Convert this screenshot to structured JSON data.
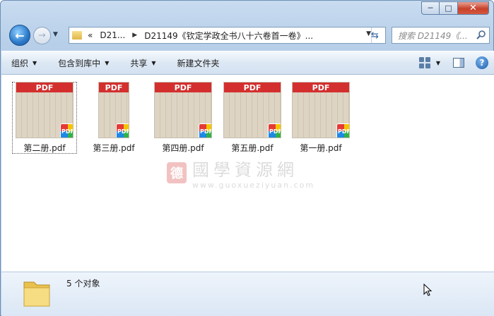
{
  "window": {
    "caption_buttons": {
      "minimize": "─",
      "maximize": "□",
      "close": "✕"
    }
  },
  "nav": {
    "back_icon": "arrow-left",
    "forward_icon": "arrow-right",
    "breadcrumb": {
      "overflow": "«",
      "parent": "D21...",
      "current": "D21149《钦定学政全书八十六卷首一卷》..."
    },
    "search_placeholder": "搜索 D21149《...",
    "refresh_icon": "refresh"
  },
  "toolbar": {
    "organize": "组织",
    "include_library": "包含到库中",
    "share": "共享",
    "new_folder": "新建文件夹"
  },
  "files": [
    {
      "name": "第二册.pdf",
      "selected": true
    },
    {
      "name": "第三册.pdf",
      "selected": false
    },
    {
      "name": "第四册.pdf",
      "selected": false
    },
    {
      "name": "第五册.pdf",
      "selected": false
    },
    {
      "name": "第一册.pdf",
      "selected": false
    }
  ],
  "pdf_label": "PDF",
  "watermark": {
    "big": "國學資源網",
    "url": "www.guoxueziyuan.com"
  },
  "status": {
    "count": "5 个对象"
  },
  "colors": {
    "pdf_red": "#d32f2f",
    "window_blue": "#b7cfe9"
  }
}
